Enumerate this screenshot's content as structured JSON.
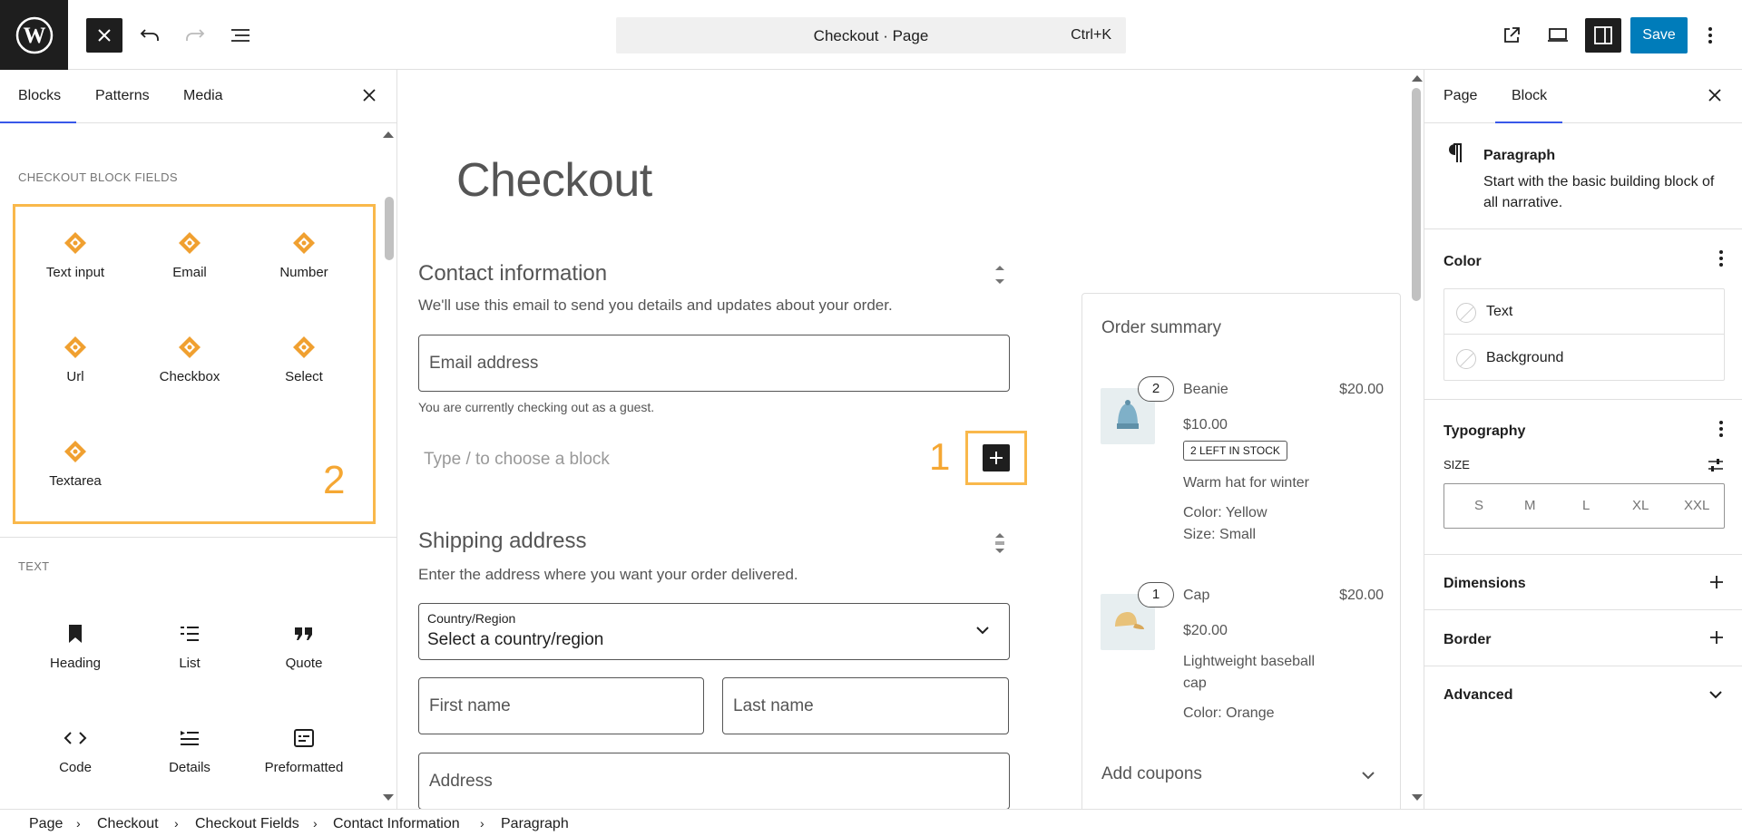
{
  "header": {
    "document_title": "Checkout · Page",
    "shortcut": "Ctrl+K",
    "save_label": "Save"
  },
  "inserter": {
    "tabs": [
      "Blocks",
      "Patterns",
      "Media"
    ],
    "active_tab": "Blocks",
    "sections": [
      {
        "title": "CHECKOUT BLOCK FIELDS",
        "items": [
          {
            "label": "Text input",
            "icon": "woo-field-icon"
          },
          {
            "label": "Email",
            "icon": "woo-field-icon"
          },
          {
            "label": "Number",
            "icon": "woo-field-icon"
          },
          {
            "label": "Url",
            "icon": "woo-field-icon"
          },
          {
            "label": "Checkbox",
            "icon": "woo-field-icon"
          },
          {
            "label": "Select",
            "icon": "woo-field-icon"
          },
          {
            "label": "Textarea",
            "icon": "woo-field-icon"
          }
        ]
      },
      {
        "title": "TEXT",
        "items": [
          {
            "label": "Heading",
            "icon": "bookmark-icon"
          },
          {
            "label": "List",
            "icon": "list-icon"
          },
          {
            "label": "Quote",
            "icon": "quote-icon"
          },
          {
            "label": "Code",
            "icon": "code-icon"
          },
          {
            "label": "Details",
            "icon": "details-icon"
          },
          {
            "label": "Preformatted",
            "icon": "preformatted-icon"
          }
        ]
      }
    ]
  },
  "annotations": {
    "marker_1": "1",
    "marker_2": "2",
    "color": "#f5a733"
  },
  "canvas": {
    "page_title": "Checkout",
    "contact": {
      "heading": "Contact information",
      "description": "We'll use this email to send you details and updates about your order.",
      "email_placeholder": "Email address",
      "guest_note": "You are currently checking out as a guest."
    },
    "appender_placeholder": "Type / to choose a block",
    "shipping": {
      "heading": "Shipping address",
      "description": "Enter the address where you want your order delivered.",
      "country_label": "Country/Region",
      "country_value": "Select a country/region",
      "first_name": "First name",
      "last_name": "Last name",
      "address": "Address"
    },
    "order_summary": {
      "title": "Order summary",
      "items": [
        {
          "qty": "2",
          "name": "Beanie",
          "total": "$20.00",
          "price": "$10.00",
          "stock_badge": "2 LEFT IN STOCK",
          "description": "Warm hat for winter",
          "meta": [
            "Color: Yellow",
            "Size: Small"
          ]
        },
        {
          "qty": "1",
          "name": "Cap",
          "total": "$20.00",
          "price": "$20.00",
          "description_lines": [
            "Lightweight baseball",
            "cap"
          ],
          "meta": [
            "Color: Orange"
          ]
        }
      ],
      "coupons": "Add coupons"
    }
  },
  "sidebar": {
    "tabs": [
      "Page",
      "Block"
    ],
    "active_tab": "Block",
    "block_name": "Paragraph",
    "block_description": "Start with the basic building block of all narrative.",
    "color": {
      "heading": "Color",
      "options": [
        "Text",
        "Background"
      ]
    },
    "typography": {
      "heading": "Typography",
      "size_label": "SIZE",
      "sizes": [
        "S",
        "M",
        "L",
        "XL",
        "XXL"
      ]
    },
    "dimensions": "Dimensions",
    "border": "Border",
    "advanced": "Advanced"
  },
  "breadcrumbs": [
    "Page",
    "Checkout",
    "Checkout Fields",
    "Contact Information",
    "Paragraph"
  ],
  "colors": {
    "accent": "#007cba",
    "tab_indicator": "#3858e9",
    "woo_orange": "#f0a030"
  }
}
